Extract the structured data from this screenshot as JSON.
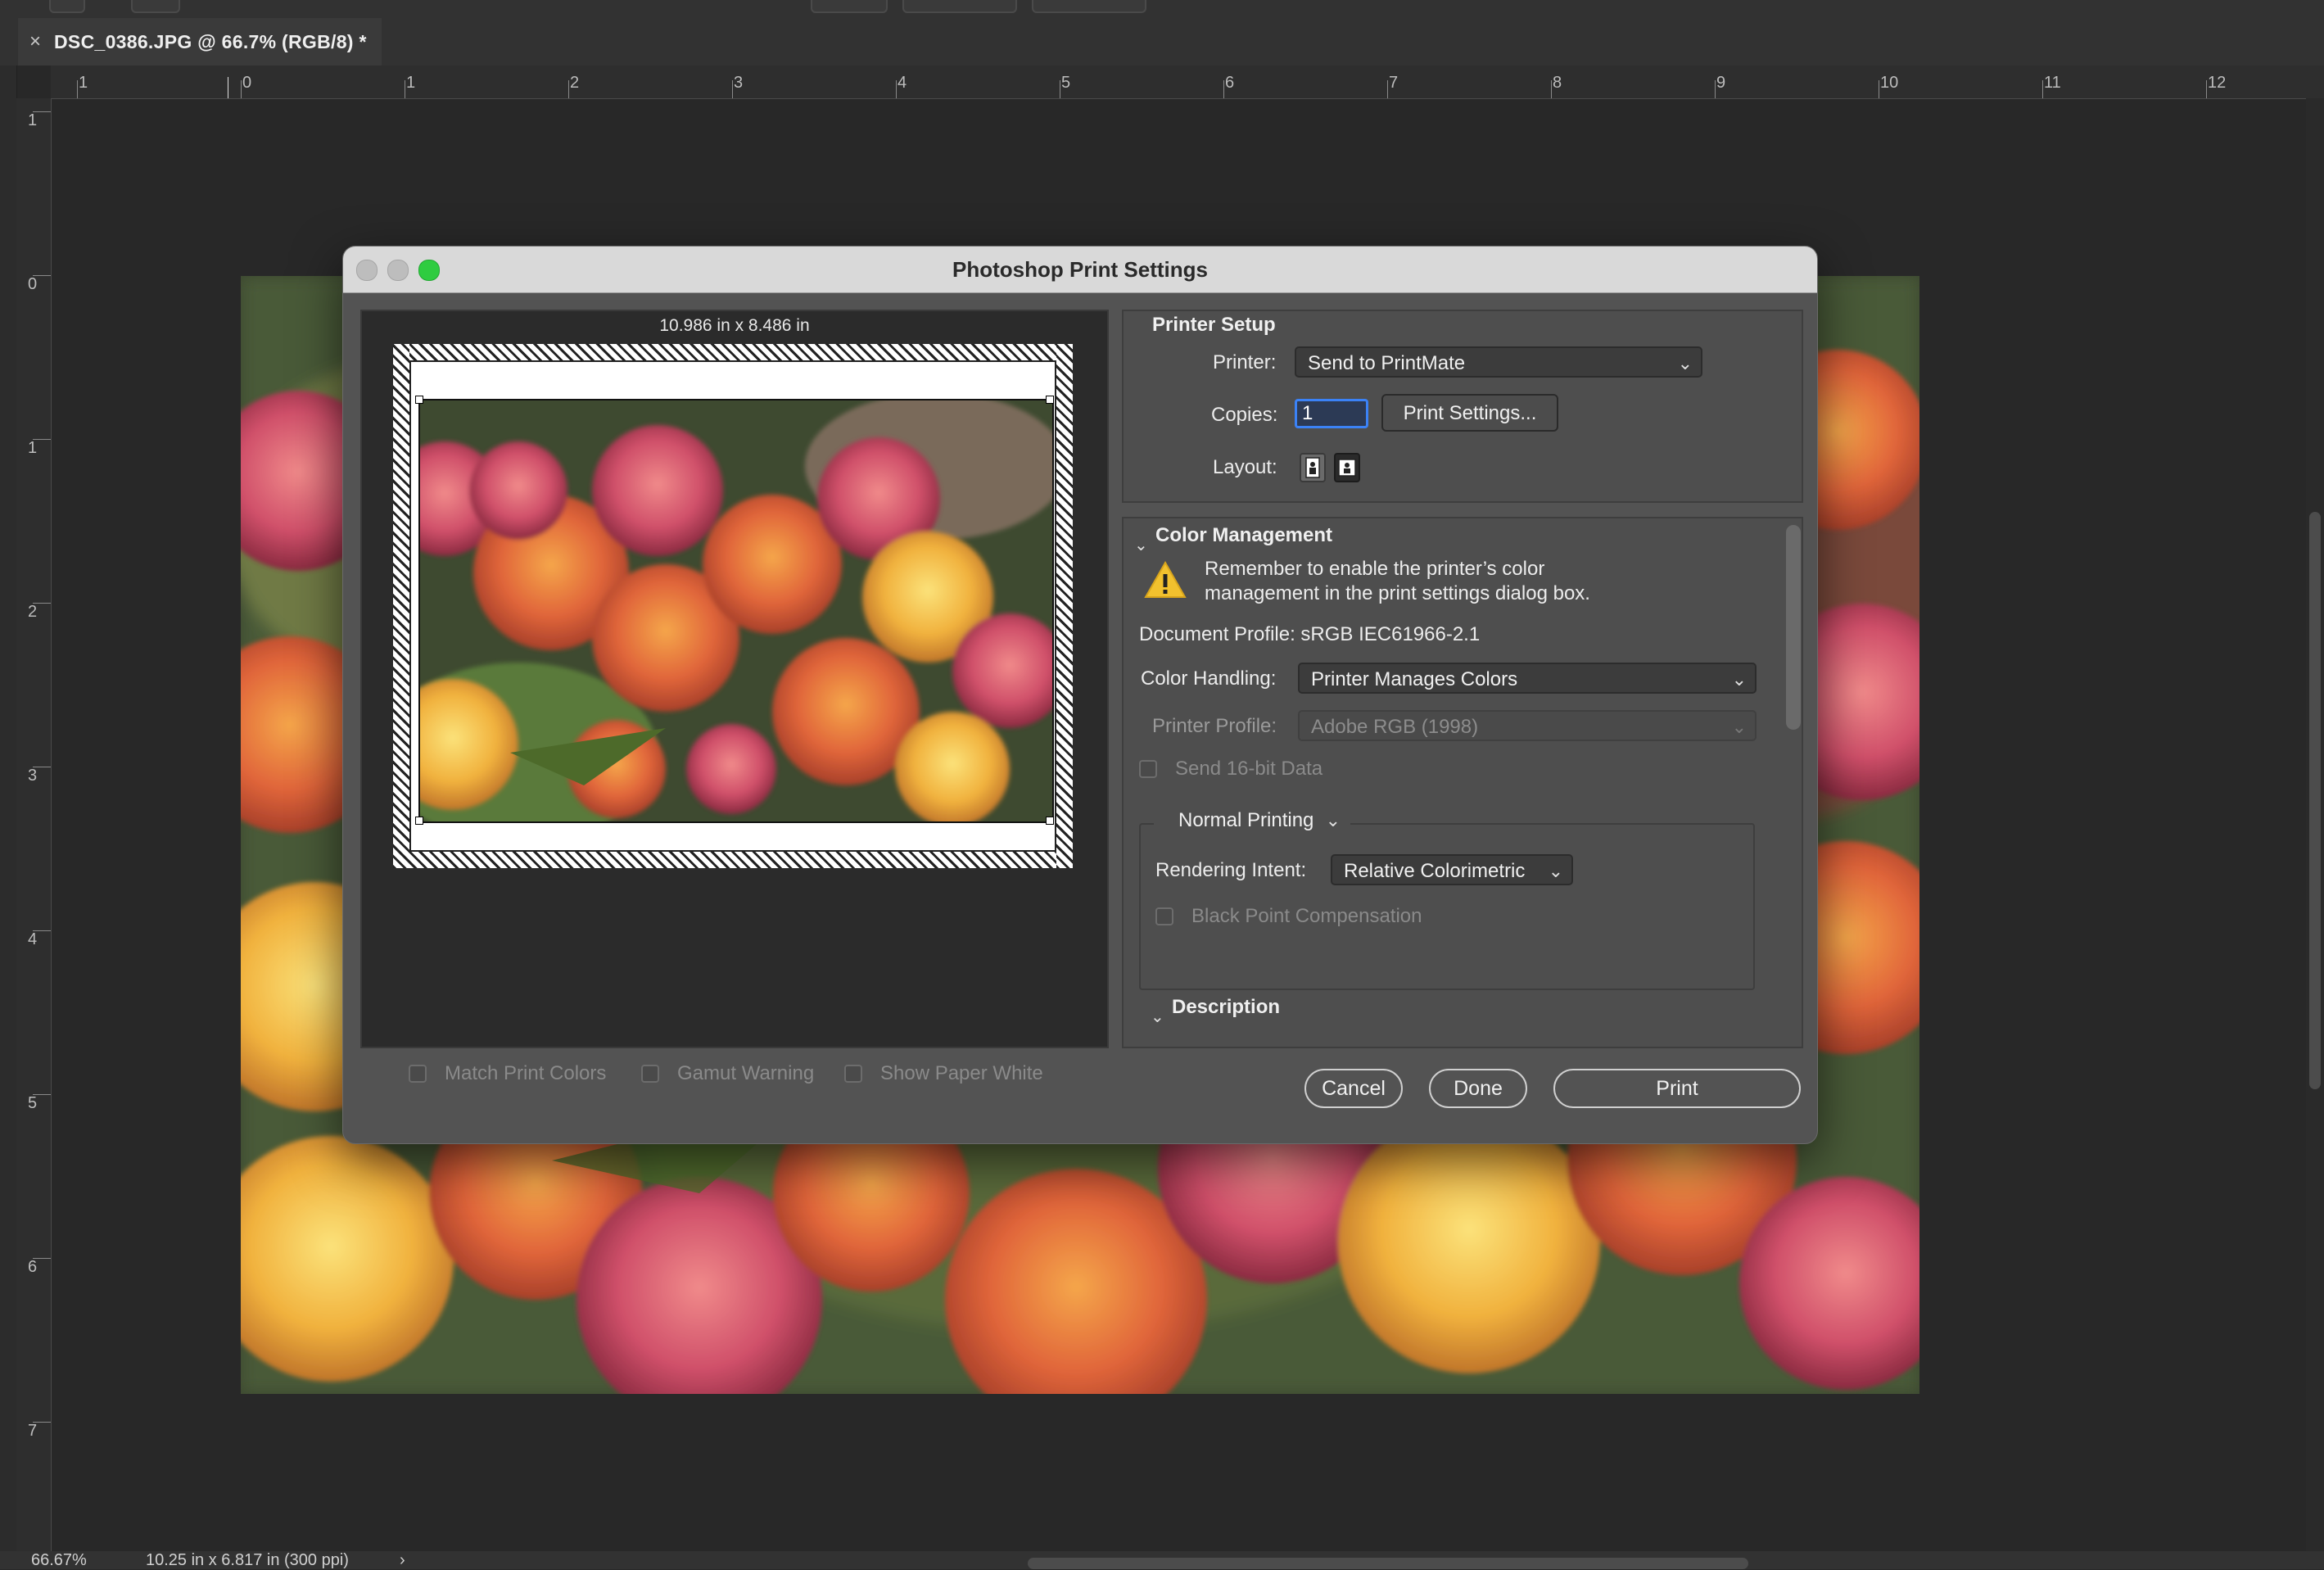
{
  "document_tab": {
    "close": "×",
    "title": "DSC_0386.JPG @ 66.7% (RGB/8) *"
  },
  "rulers": {
    "horizontal": [
      "1",
      "0",
      "1",
      "2",
      "3",
      "4",
      "5",
      "6",
      "7",
      "8",
      "9",
      "10",
      "11",
      "12"
    ],
    "vertical": [
      "1",
      "0",
      "1",
      "2",
      "3",
      "4",
      "5",
      "6",
      "7"
    ]
  },
  "status_bar": {
    "zoom": "66.67%",
    "doc_info": "10.25 in x 6.817 in (300 ppi)",
    "arrow": "›"
  },
  "dialog": {
    "title": "Photoshop Print Settings",
    "preview": {
      "paper_size": "10.986 in x 8.486 in"
    },
    "preview_options": [
      {
        "label": "Match Print Colors",
        "checked": false
      },
      {
        "label": "Gamut Warning",
        "checked": false
      },
      {
        "label": "Show Paper White",
        "checked": false
      }
    ],
    "printer_setup": {
      "header": "Printer Setup",
      "printer_label": "Printer:",
      "printer_value": "Send to PrintMate",
      "copies_label": "Copies:",
      "copies_value": "1",
      "print_settings_button": "Print Settings...",
      "layout_label": "Layout:"
    },
    "color_management": {
      "header": "Color Management",
      "warning_line1": "Remember to enable the printer’s color",
      "warning_line2": "management in the print settings dialog box.",
      "document_profile": "Document Profile: sRGB IEC61966-2.1",
      "color_handling_label": "Color Handling:",
      "color_handling_value": "Printer Manages Colors",
      "printer_profile_label": "Printer Profile:",
      "printer_profile_value": "Adobe RGB (1998)",
      "send_16bit": "Send 16-bit Data",
      "printing_mode": "Normal Printing",
      "rendering_intent_label": "Rendering Intent:",
      "rendering_intent_value": "Relative Colorimetric",
      "black_point": "Black Point Compensation"
    },
    "description_header": "Description",
    "buttons": {
      "cancel": "Cancel",
      "done": "Done",
      "print": "Print"
    }
  },
  "colors": {
    "accent_green": "#2ecc40",
    "warning_yellow": "#f2c12e",
    "focus_blue": "#3b82f6"
  }
}
